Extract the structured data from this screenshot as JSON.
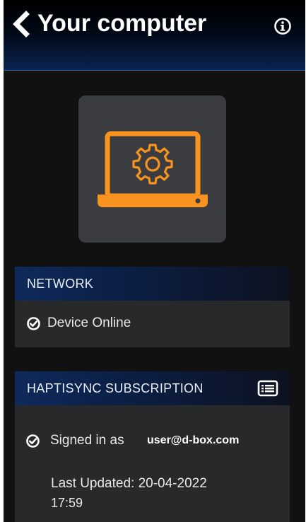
{
  "header": {
    "title": "Your computer",
    "back_icon": "chevron-left-icon",
    "info_icon": "info-circle-icon"
  },
  "device": {
    "icon": "laptop-gear-icon"
  },
  "network": {
    "title": "NETWORK",
    "status_text": "Device Online",
    "status_icon": "check-circle-icon"
  },
  "subscription": {
    "title": "HAPTISYNC SUBSCRIPTION",
    "details_icon": "list-card-icon",
    "signed_in_label": "Signed in as",
    "user_email": "user@d-box.com",
    "last_updated_line1": "Last Updated: 20-04-2022",
    "last_updated_line2": "17:59"
  },
  "colors": {
    "accent_orange": "#f7931e",
    "header_blue": "#0b2250",
    "panel_bg": "#28292b",
    "tile_bg": "#3b3c3f"
  }
}
